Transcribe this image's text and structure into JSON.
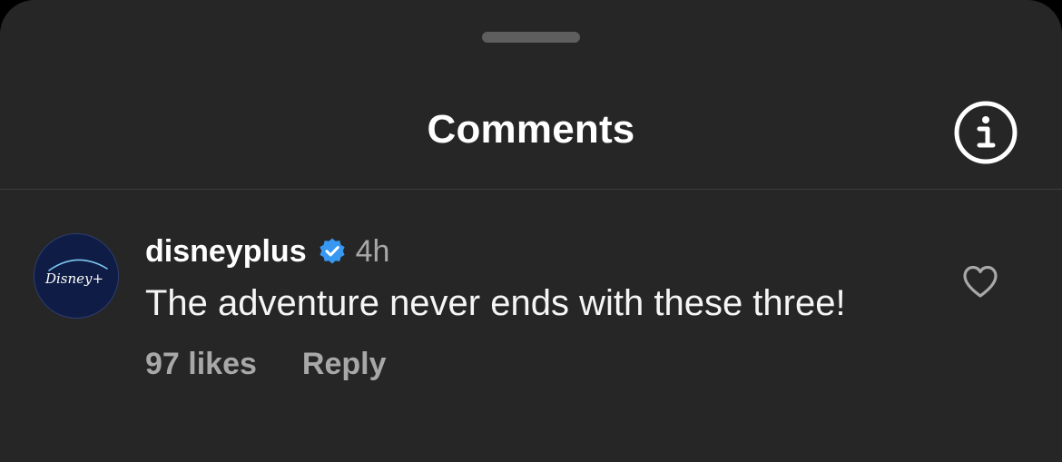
{
  "header": {
    "title": "Comments",
    "info_icon": "info-circle-icon"
  },
  "comment": {
    "avatar": {
      "brand_text": "Disney+",
      "background": "#0f1c45"
    },
    "username": "disneyplus",
    "verified_icon": "verified-badge-icon",
    "verified_color": "#3897f0",
    "timestamp": "4h",
    "text": "The adventure never ends with these three!",
    "likes_label": "97 likes",
    "reply_label": "Reply",
    "like_icon": "heart-outline-icon"
  },
  "colors": {
    "sheet_background": "#262626",
    "secondary_text": "#a8a8a8",
    "primary_text": "#f5f5f5"
  }
}
